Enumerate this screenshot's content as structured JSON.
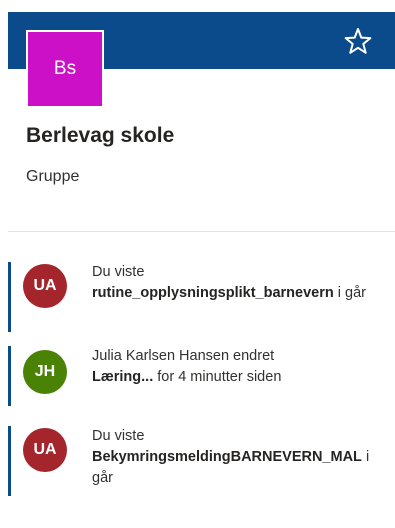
{
  "site": {
    "logo_text": "Bs",
    "title": "Berlevag skole",
    "subtitle": "Gruppe",
    "favorite_icon": "star-outline-icon"
  },
  "activities": [
    {
      "initials": "UA",
      "avatar_color": "#a4262c",
      "line1": "Du viste",
      "doc": "rutine_opplysningsplikt_barnevern",
      "suffix": " i går"
    },
    {
      "initials": "JH",
      "avatar_color": "#498205",
      "line1": "Julia Karlsen Hansen endret",
      "doc": "Læring...",
      "suffix": " for 4 minutter siden"
    },
    {
      "initials": "UA",
      "avatar_color": "#a4262c",
      "line1": "Du viste",
      "doc": "BekymringsmeldingBARNEVERN_MAL",
      "suffix": " i går"
    }
  ],
  "colors": {
    "header": "#0b4a8b",
    "logo": "#cc10c8",
    "accent_bar": "#0b4a8b"
  }
}
